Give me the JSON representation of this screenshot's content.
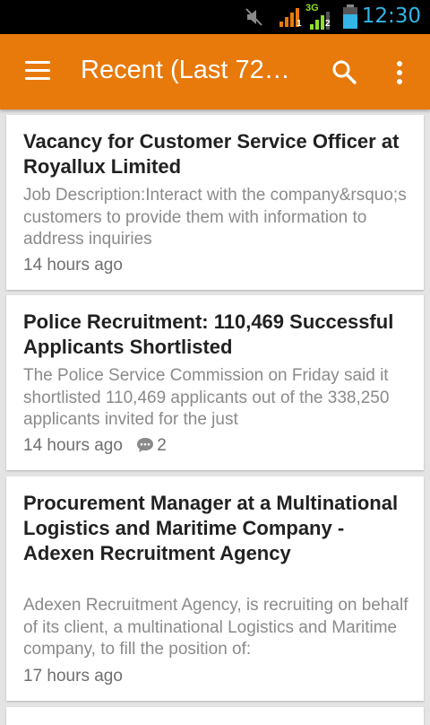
{
  "status_bar": {
    "time": "12:30",
    "network_label": "3G",
    "sim_labels": [
      "1",
      "2"
    ]
  },
  "app_bar": {
    "title": "Recent (Last 72…",
    "icons": [
      "menu-icon",
      "search-icon",
      "more-vert-icon"
    ],
    "color": "#e8790b"
  },
  "articles": [
    {
      "title": "Vacancy for Customer Service Officer at Royallux Limited",
      "description": "Job Description:Interact with the company&rsquo;s customers to provide them with information to address inquiries",
      "time": "14 hours ago",
      "comments": ""
    },
    {
      "title": "Police Recruitment: 110,469 Successful Applicants Shortlisted",
      "description": "The Police Service Commission on Friday said it shortlisted 110,469 applicants out of the 338,250 applicants invited for the just",
      "time": "14 hours ago",
      "comments": "2"
    },
    {
      "title": "Procurement Manager at a Multinational Logistics and Maritime Company - Adexen Recruitment Agency",
      "description": "Adexen Recruitment Agency, is recruiting on behalf of its client, a multinational Logistics and Maritime company, to fill the position of:",
      "time": "17 hours ago",
      "comments": ""
    }
  ]
}
